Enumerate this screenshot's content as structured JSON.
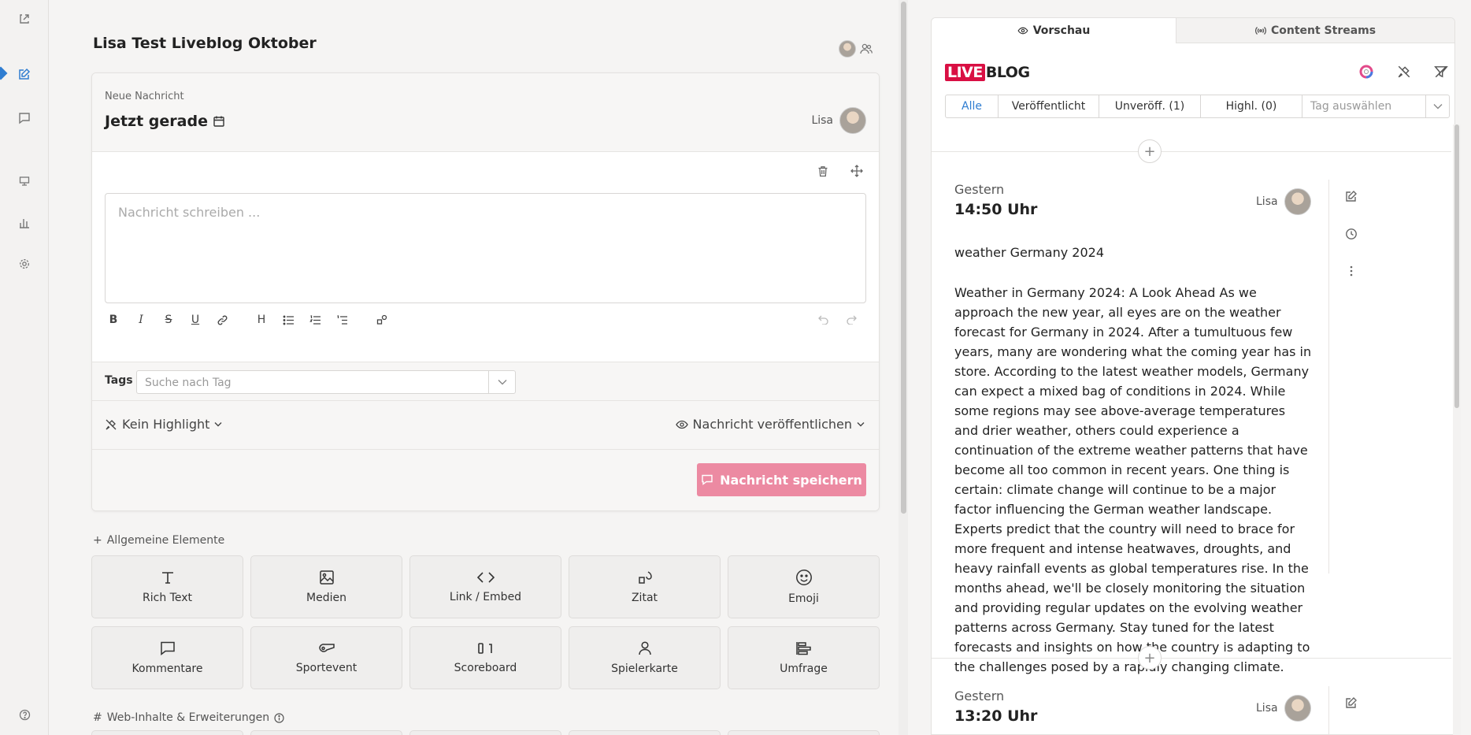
{
  "editor": {
    "title": "Lisa Test Liveblog Oktober",
    "card": {
      "kicker": "Neue Nachricht",
      "when": "Jetzt gerade",
      "author": "Lisa",
      "placeholder": "Nachricht schreiben ...",
      "tags_label": "Tags",
      "tags_placeholder": "Suche nach Tag",
      "highlight": "Kein Highlight",
      "publish": "Nachricht veröffentlichen",
      "save": "Nachricht speichern"
    },
    "section_general": "Allgemeine Elemente",
    "section_web": "Web-Inhalte & Erweiterungen",
    "tiles": [
      {
        "label": "Rich Text",
        "icon": "text-icon"
      },
      {
        "label": "Medien",
        "icon": "image-icon"
      },
      {
        "label": "Link / Embed",
        "icon": "code-icon"
      },
      {
        "label": "Zitat",
        "icon": "quote-icon"
      },
      {
        "label": "Emoji",
        "icon": "smiley-icon"
      },
      {
        "label": "Kommentare",
        "icon": "comment-icon"
      },
      {
        "label": "Sportevent",
        "icon": "whistle-icon"
      },
      {
        "label": "Scoreboard",
        "icon": "scoreboard-icon"
      },
      {
        "label": "Spielerkarte",
        "icon": "person-icon"
      },
      {
        "label": "Umfrage",
        "icon": "poll-icon"
      }
    ]
  },
  "preview": {
    "tabs": {
      "preview": "Vorschau",
      "streams": "Content Streams"
    },
    "logo": {
      "live": "LIVE",
      "blog": "BLOG"
    },
    "filters": {
      "all": "Alle",
      "published": "Veröffentlicht",
      "unpublished": "Unveröff. (1)",
      "highlights": "Highl. (0)",
      "tag_placeholder": "Tag auswählen"
    },
    "entries": [
      {
        "day": "Gestern",
        "time": "14:50 Uhr",
        "author": "Lisa",
        "headline": "weather Germany 2024",
        "body": "Weather in Germany 2024: A Look Ahead As we approach the new year, all eyes are on the weather forecast for Germany in 2024. After a tumultuous few years, many are wondering what the coming year has in store. According to the latest weather models, Germany can expect a mixed bag of conditions in 2024. While some regions may see above-average temperatures and drier weather, others could experience a continuation of the extreme weather patterns that have become all too common in recent years. One thing is certain: climate change will continue to be a major factor influencing the German weather landscape. Experts predict that the country will need to brace for more frequent and intense heatwaves, droughts, and heavy rainfall events as global temperatures rise. In the months ahead, we'll be closely monitoring the situation and providing regular updates on the evolving weather patterns across Germany. Stay tuned for the latest forecasts and insights on how the country is adapting to the challenges posed by a rapidly changing climate."
      },
      {
        "day": "Gestern",
        "time": "13:20 Uhr",
        "author": "Lisa"
      }
    ]
  },
  "colors": {
    "accent": "#2f7dd1",
    "brand": "#d90f43",
    "save_button": "#ec8aa2"
  }
}
